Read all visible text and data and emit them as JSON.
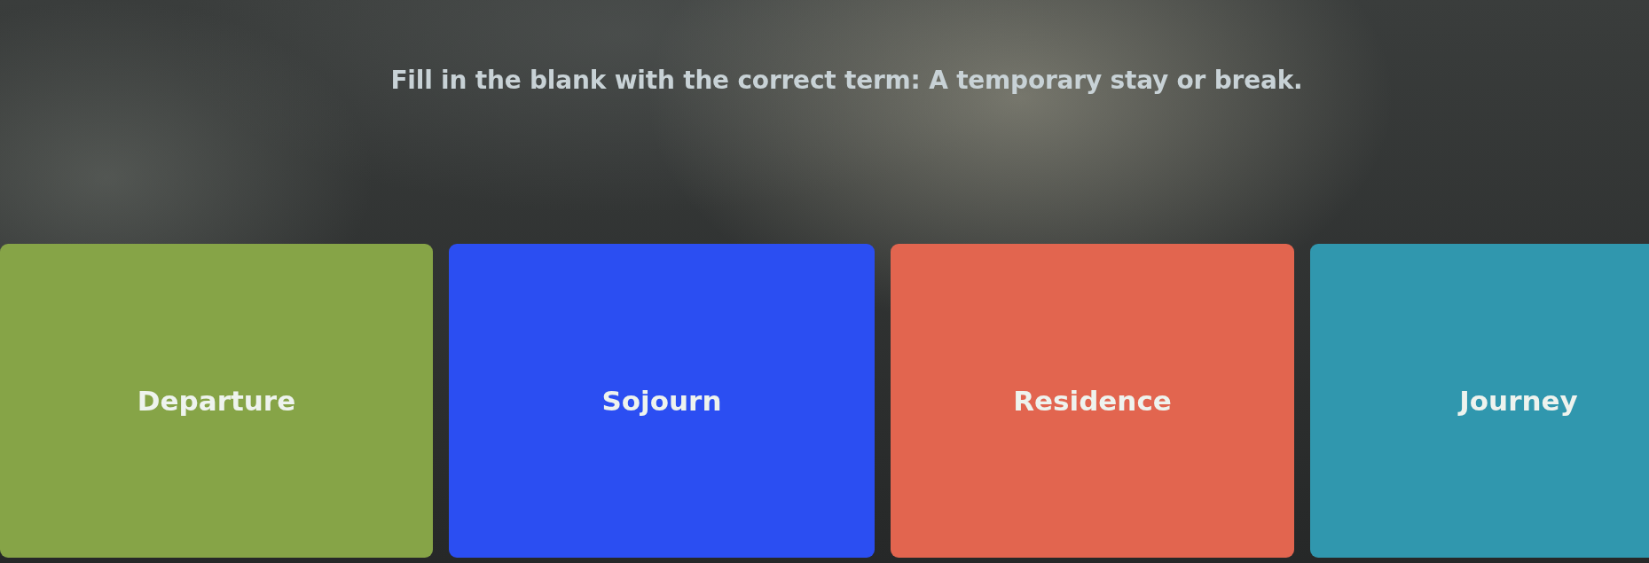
{
  "question": {
    "text": "Fill in the blank with the correct term: A temporary stay or break."
  },
  "options": [
    {
      "label": "Departure",
      "color": "#86a447"
    },
    {
      "label": "Sojourn",
      "color": "#2b4ef2"
    },
    {
      "label": "Residence",
      "color": "#e2654f"
    },
    {
      "label": "Journey",
      "color": "#3097ae"
    }
  ]
}
